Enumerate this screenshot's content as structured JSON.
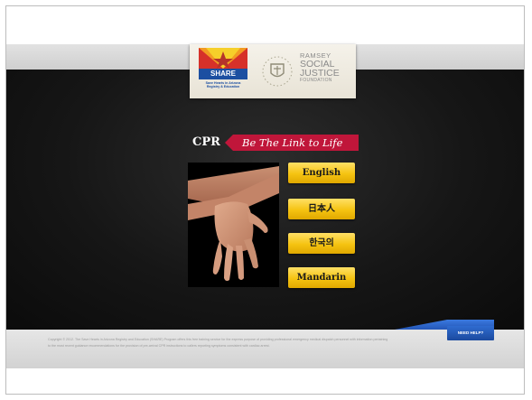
{
  "header": {
    "share_logo": {
      "name": "SHARE",
      "subtitle": "Save Hearts in Arizona Registry & Education",
      "colors": {
        "blue": "#1c4fa1",
        "red": "#d6312a",
        "orange": "#f29b22",
        "yellow": "#f6cf2a"
      }
    },
    "foundation_logo": {
      "line1": "RAMSEY",
      "line2": "SOCIAL",
      "line3": "JUSTICE",
      "line4": "FOUNDATION",
      "icon": "seal-icon"
    }
  },
  "tagline": {
    "cpr": "CPR",
    "slogan": "Be The Link to Life",
    "ribbon_color": "#c0163a"
  },
  "photo": {
    "icon": "hands-cpr-photo"
  },
  "languages": [
    {
      "label": "English"
    },
    {
      "label": "日本人"
    },
    {
      "label": "한국의"
    },
    {
      "label": "Mandarin"
    }
  ],
  "footer": {
    "copyright": "Copyright © 2012. The Save Hearts in Arizona Registry and Education (SHARE) Program offers this free training service for the express purpose of providing professional emergency medical dispatch personnel with information pertaining to the most recent guidance recommendations for the provision of pre-arrival CPR instructions to callers reporting symptoms consistent with cardiac arrest.",
    "help_label": "NEED HELP?"
  },
  "colors": {
    "button_gold": "#f5c311",
    "help_blue": "#1b4a9e",
    "background": "#161616"
  }
}
